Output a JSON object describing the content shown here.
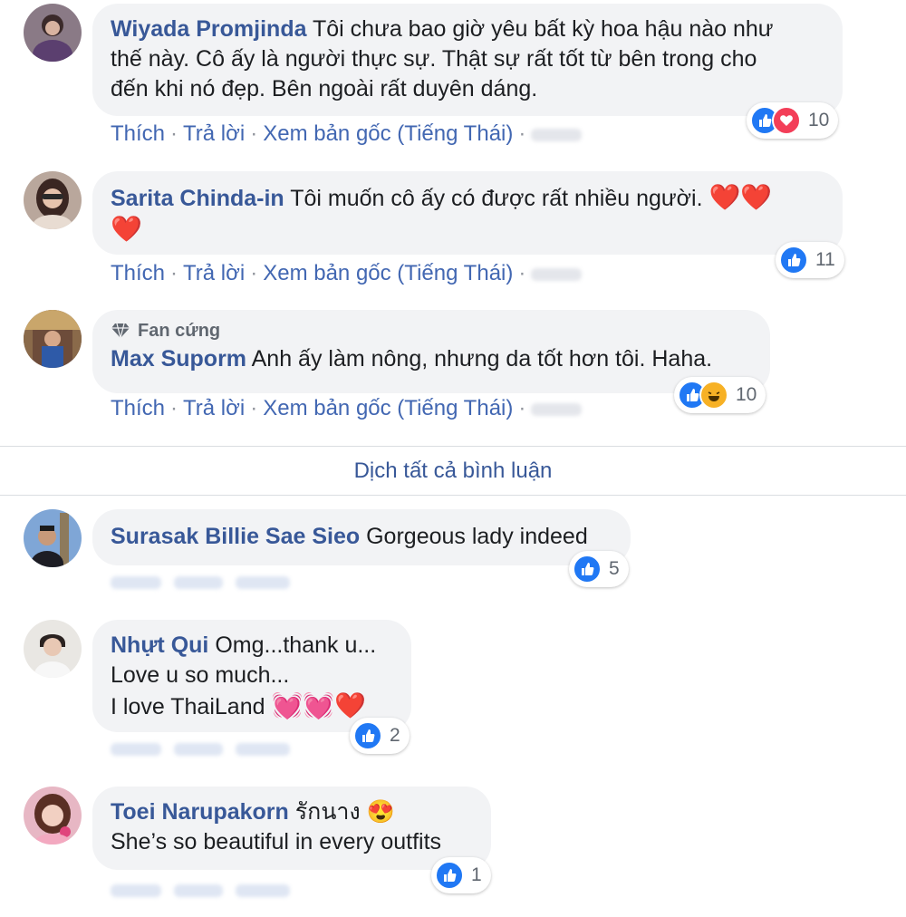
{
  "actions": {
    "like": "Thích",
    "reply": "Trả lời",
    "see_original": "Xem bản gốc (Tiếng Thái)"
  },
  "translate_all": "Dịch tất cả bình luận",
  "comments": [
    {
      "author": "Wiyada Promjinda",
      "lines": [
        "Tôi chưa bao giờ yêu bất kỳ hoa hậu nào như",
        "thế này. Cô ấy là người thực sự. Thật sự rất tốt từ bên trong cho",
        "đến khi nó đẹp. Bên ngoài rất duyên dáng."
      ],
      "reactions": [
        "like",
        "love"
      ],
      "count": "10"
    },
    {
      "author": "Sarita Chinda-in",
      "text": "Tôi muốn cô ấy có được rất nhiều người.",
      "emoji": "❤️❤️",
      "emoji2": "❤️",
      "reactions": [
        "like"
      ],
      "count": "11"
    },
    {
      "badge": "Fan cứng",
      "author": "Max Suporm",
      "text": "Anh ấy làm nông, nhưng da tốt hơn tôi. Haha.",
      "reactions": [
        "like",
        "haha"
      ],
      "count": "10"
    },
    {
      "author": "Surasak Billie Sae Sieo",
      "text": "Gorgeous lady indeed",
      "reactions": [
        "like"
      ],
      "count": "5"
    },
    {
      "author": "Nhựt Qui",
      "text": "Omg...thank u...",
      "line2": "Love u so much...",
      "line3": "I love ThaiLand",
      "emoji": "💓💓❤️",
      "reactions": [
        "like"
      ],
      "count": "2"
    },
    {
      "author": "Toei Narupakorn",
      "text": "รักนาง",
      "emoji": "😍",
      "line2": "She’s so beautiful in every outfits",
      "reactions": [
        "like"
      ],
      "count": "1"
    }
  ],
  "colors": {
    "author": "#385898",
    "link": "#4267b2",
    "bubble": "#f2f3f5",
    "like": "#2078f4",
    "love": "#f33e58",
    "haha": "#f7b125"
  }
}
